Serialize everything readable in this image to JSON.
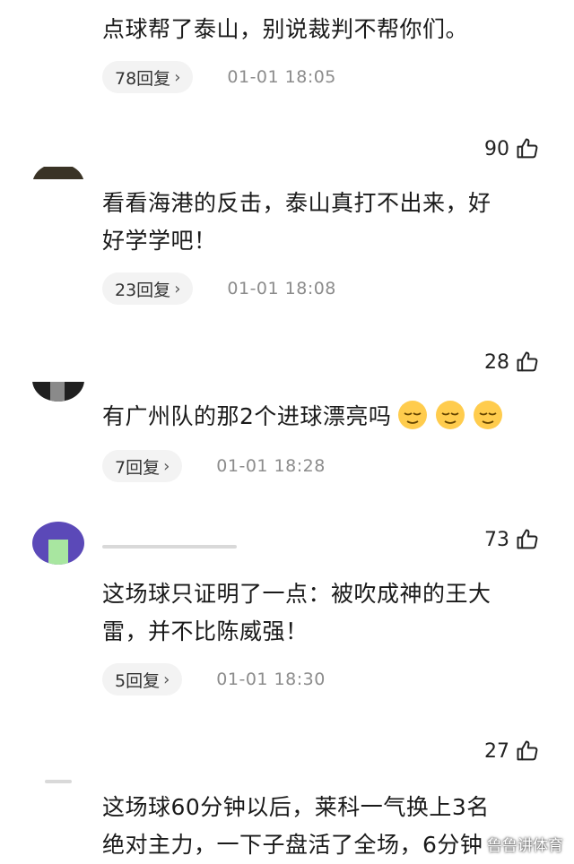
{
  "comments": [
    {
      "text_lines": [
        "点球帮了泰山，别说裁判不帮你们。"
      ],
      "reply_label": "78回复",
      "timestamp": "01-01 18:05",
      "likes": "90"
    },
    {
      "text_lines": [
        "看看海港的反击，泰山真打不出来，好",
        "好学学吧！"
      ],
      "reply_label": "23回复",
      "timestamp": "01-01 18:08",
      "likes": "28"
    },
    {
      "text_lines": [
        "有广州队的那2个进球漂亮吗"
      ],
      "emojis": [
        "relieved-face-emoji",
        "relieved-face-emoji",
        "relieved-face-emoji"
      ],
      "reply_label": "7回复",
      "timestamp": "01-01 18:28",
      "likes": "73"
    },
    {
      "text_lines": [
        "这场球只证明了一点：被吹成神的王大",
        "雷，并不比陈威强！"
      ],
      "reply_label": "5回复",
      "timestamp": "01-01 18:30",
      "likes": "27"
    },
    {
      "text_lines": [
        "这场球60分钟以后，莱科一气换上3名",
        "绝对主力，一下子盘活了全场，6分钟"
      ]
    }
  ],
  "watermark": "鲁鲁讲体育",
  "icons": {
    "like": "thumbs-up-icon",
    "reply_chevron": "chevron-right-icon"
  },
  "colors": {
    "reply_bg": "#f3f3f3",
    "timestamp": "#8c8c8c",
    "text": "#1a1a1a"
  }
}
